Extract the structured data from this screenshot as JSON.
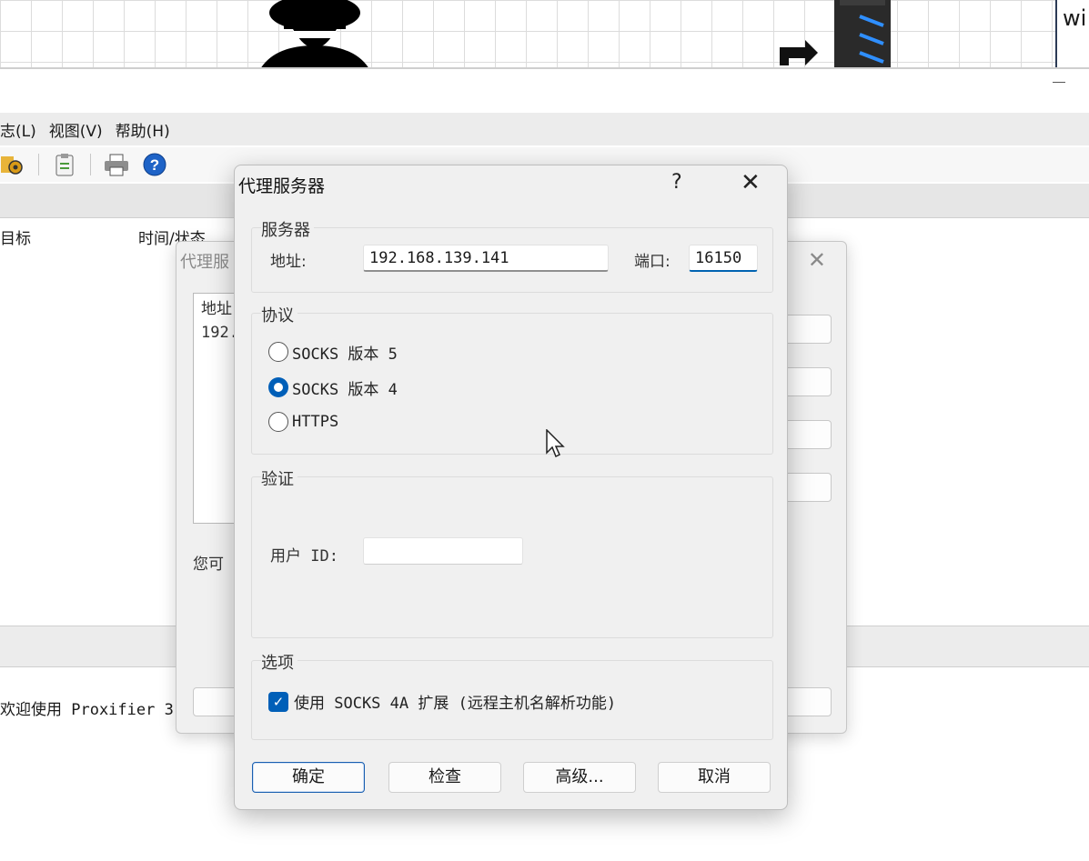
{
  "diagram": {
    "server_box_text": "wi"
  },
  "app": {
    "menu": [
      "志(L)",
      "视图(V)",
      "帮助(H)"
    ],
    "columns": {
      "target": "目标",
      "time_status": "时间/状态"
    },
    "log_line": "欢迎使用 Proxifier 3"
  },
  "mid_dialog": {
    "title": "代理服",
    "list_header": "地址",
    "list_value": "192.",
    "button_label": "..",
    "hint": "您可"
  },
  "dialog": {
    "title": "代理服务器",
    "help": "?",
    "close": "✕",
    "server": {
      "group_title": "服务器",
      "address_label": "地址:",
      "address_value": "192.168.139.141",
      "port_label": "端口:",
      "port_value": "16150"
    },
    "protocol": {
      "group_title": "协议",
      "options": [
        {
          "label": "SOCKS 版本 5",
          "checked": false
        },
        {
          "label": "SOCKS 版本 4",
          "checked": true
        },
        {
          "label": "HTTPS",
          "checked": false
        }
      ]
    },
    "auth": {
      "group_title": "验证",
      "user_id_label": "用户 ID:",
      "user_id_value": ""
    },
    "options": {
      "group_title": "选项",
      "socks4a_label": "使用 SOCKS 4A 扩展 (远程主机名解析功能)",
      "socks4a_checked": true
    },
    "buttons": {
      "ok": "确定",
      "check": "检查",
      "advanced": "高级...",
      "cancel": "取消"
    }
  },
  "colors": {
    "accent": "#005fb8",
    "dialog_bg": "#f0f0f0"
  },
  "icons": [
    "spy-icon",
    "server-icon",
    "arrow-icon",
    "settings-icon",
    "clipboard-icon",
    "printer-icon",
    "help-icon",
    "mouse-cursor-icon"
  ]
}
